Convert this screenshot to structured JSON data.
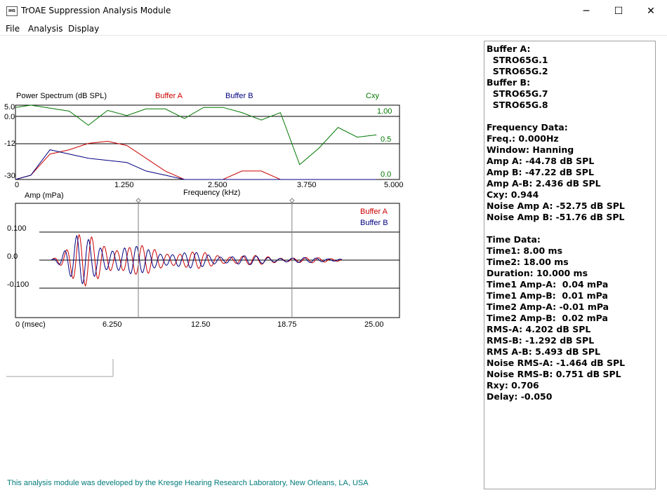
{
  "window": {
    "title": "TrOAE Suppression Analysis Module",
    "icon_text": "IHS",
    "minimize_glyph": "─",
    "maximize_glyph": "☐",
    "close_glyph": "✕"
  },
  "menu": {
    "file": "File",
    "analysis": "Analysis",
    "display": "Display"
  },
  "spectrum": {
    "title": "Power Spectrum (dB SPL)",
    "legend_a": "Buffer A",
    "legend_b": "Buffer B",
    "legend_cxy": "Cxy",
    "y_ticks": [
      "5.0",
      "0.0",
      "-12",
      "-30"
    ],
    "cxy_ticks": [
      "1.00",
      "0.5",
      "0.0"
    ],
    "x_ticks": [
      "0",
      "1.250",
      "2.500",
      "3.750",
      "5.000"
    ],
    "xlabel": "Frequency (kHz)",
    "colors": {
      "a": "#cc0000",
      "b": "#000080",
      "cxy": "#007700"
    }
  },
  "waveform": {
    "ylabel": "Amp (mPa)",
    "legend_a": "Buffer A",
    "legend_b": "Buffer B",
    "y_ticks": [
      "0.100",
      "0.0",
      "-0.100"
    ],
    "x_ticks": [
      "0 (msec)",
      "6.250",
      "12.50",
      "18.75",
      "25.00"
    ],
    "cursor1_ms": 8.0,
    "cursor2_ms": 18.0
  },
  "chart_data": [
    {
      "type": "line",
      "ylabel": "Power Spectrum (dB SPL)",
      "xlabel": "Frequency (kHz)",
      "xlim": [
        0,
        5.0
      ],
      "ylim": [
        -30,
        5.0
      ],
      "x": [
        0,
        0.2,
        0.45,
        0.7,
        0.95,
        1.2,
        1.45,
        1.7,
        1.95,
        2.2,
        2.45,
        2.7,
        2.95,
        3.2,
        3.45,
        3.7,
        3.95,
        4.2,
        4.45,
        4.7
      ],
      "series": [
        {
          "name": "Buffer A",
          "values": [
            -30,
            -28,
            -18,
            -16,
            -13,
            -12,
            -14,
            -20,
            -26,
            -30,
            -30,
            -30,
            -26,
            -26,
            -30,
            -30,
            -30,
            -30,
            -30,
            -30
          ]
        },
        {
          "name": "Buffer B",
          "values": [
            -30,
            -28,
            -16,
            -18,
            -20,
            -21,
            -22,
            -26,
            -28,
            -30,
            -30,
            -30,
            -30,
            -30,
            -30,
            -30,
            -30,
            -30,
            -30,
            -30
          ]
        }
      ],
      "secondary": {
        "name": "Cxy",
        "ylim": [
          0.0,
          1.0
        ],
        "values": [
          0.97,
          1.0,
          0.96,
          0.92,
          0.73,
          0.93,
          0.86,
          0.95,
          0.95,
          0.82,
          0.97,
          0.97,
          0.9,
          0.8,
          0.9,
          0.2,
          0.42,
          0.7,
          0.57,
          0.6
        ]
      }
    },
    {
      "type": "line",
      "ylabel": "Amp (mPa)",
      "xlim": [
        0,
        25.0
      ],
      "ylim": [
        -0.2,
        0.2
      ],
      "series": [
        {
          "name": "Buffer A",
          "envelope": {
            "start_ms": 2.3,
            "peak_ms": 4.0,
            "end_ms": 21.3,
            "peak_amp": 0.1,
            "period_ms": 0.82
          }
        },
        {
          "name": "Buffer B",
          "envelope": {
            "start_ms": 2.3,
            "peak_ms": 4.0,
            "end_ms": 21.3,
            "peak_amp": 0.09,
            "period_ms": 0.78
          }
        }
      ]
    }
  ],
  "info": {
    "lines": [
      "Buffer A:",
      "  STRO65G.1",
      "  STRO65G.2",
      "Buffer B:",
      "  STRO65G.7",
      "  STRO65G.8",
      "",
      "Frequency Data:",
      "Freq.: 0.000Hz",
      "Window: Hanning",
      "Amp A: -44.78 dB SPL",
      "Amp B: -47.22 dB SPL",
      "Amp A-B: 2.436 dB SPL",
      "Cxy: 0.944",
      "Noise Amp A: -52.75 dB SPL",
      "Noise Amp B: -51.76 dB SPL",
      "",
      "Time Data:",
      "Time1: 8.00 ms",
      "Time2: 18.00 ms",
      "Duration: 10.000 ms",
      "Time1 Amp-A:  0.04 mPa",
      "Time1 Amp-B:  0.01 mPa",
      "Time2 Amp-A: -0.01 mPa",
      "Time2 Amp-B:  0.02 mPa",
      "RMS-A: 4.202 dB SPL",
      "RMS-B: -1.292 dB SPL",
      "RMS A-B: 5.493 dB SPL",
      "Noise RMS-A: -1.464 dB SPL",
      "Noise RMS-B: 0.751 dB SPL",
      "Rxy: 0.706",
      "Delay: -0.050"
    ]
  },
  "footer": "This analysis module was developed by the Kresge Hearing Research Laboratory, New Orleans, LA, USA"
}
